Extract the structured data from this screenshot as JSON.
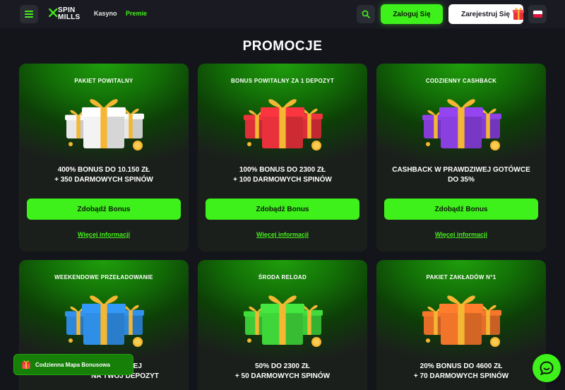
{
  "header": {
    "logo_top": "SPIN",
    "logo_bottom": "MILLS",
    "nav": [
      {
        "label": "Kasyno"
      },
      {
        "label": "Premie"
      }
    ],
    "login_label": "Zaloguj Się",
    "register_label": "Zarejestruj Się",
    "language": "pl"
  },
  "page_title": "PROMOCJE",
  "cards": [
    {
      "title": "PAKIET POWITALNY",
      "desc": "400% BONUS DO 10.150 ZŁ\n+ 350 DARMOWYCH SPINÓW",
      "cta": "Zdobądź Bonus",
      "more": "Więcej informacji",
      "gift_color": "#f3f3f3"
    },
    {
      "title": "BONUS POWITALNY ZA 1 DEPOZYT",
      "desc": "100% BONUS DO 2300 ZŁ\n+ 100 DARMOWYCH SPINÓW",
      "cta": "Zdobądź Bonus",
      "more": "Więcej informacji",
      "gift_color": "#e8313b"
    },
    {
      "title": "CODZIENNY CASHBACK",
      "desc": "CASHBACK W PRAWDZIWEJ GOTÓWCE\nDO 35%",
      "cta": "Zdobądź Bonus",
      "more": "Więcej informacji",
      "gift_color": "#8a3fe0"
    },
    {
      "title": "WEEKENDOWE PRZEŁADOWANIE",
      "desc": "…DZIWEJ\nNA TWÓJ DEPOZYT",
      "gift_color": "#2f8ee6"
    },
    {
      "title": "ŚRODA RELOAD",
      "desc": "50% DO 2300 ZŁ\n+ 50 DARMOWYCH SPINÓW",
      "gift_color": "#3fd63a"
    },
    {
      "title": "PAKIET ZAKŁADÓW N°1",
      "desc": "20% BONUS DO 4600 ZŁ\n+ 70 DARMOWYCH SPINÓW",
      "gift_color": "#f0742a"
    }
  ],
  "bonus_map_label": "Codzienna Mapa Bonusowa",
  "colors": {
    "accent": "#3ef11b",
    "background": "#14151b",
    "header": "#1a1b22"
  }
}
